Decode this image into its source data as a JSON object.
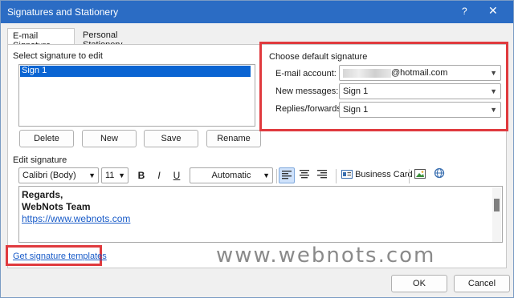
{
  "window": {
    "title": "Signatures and Stationery",
    "help_icon": "?",
    "close_icon": "✕"
  },
  "tabs": [
    {
      "label": "E-mail Signature",
      "active": true
    },
    {
      "label": "Personal Stationery",
      "active": false
    }
  ],
  "select_signature": {
    "label": "Select signature to edit",
    "items": [
      "Sign 1"
    ],
    "selected": "Sign 1"
  },
  "list_buttons": {
    "delete": "Delete",
    "new": "New",
    "save": "Save",
    "rename": "Rename"
  },
  "default_signature": {
    "heading": "Choose default signature",
    "account_label": "E-mail account:",
    "account_value": "@hotmail.com",
    "new_messages_label": "New messages:",
    "new_messages_value": "Sign 1",
    "replies_label": "Replies/forwards:",
    "replies_value": "Sign 1"
  },
  "edit_signature": {
    "label": "Edit signature",
    "font": "Calibri (Body)",
    "size": "11",
    "bold": "B",
    "italic": "I",
    "underline": "U",
    "color": "Automatic",
    "business_card": "Business Card",
    "content_lines": [
      "Regards,",
      "WebNots Team"
    ],
    "link": "https://www.webnots.com"
  },
  "footer": {
    "templates_link": "Get signature templates",
    "watermark": "www.webnots.com",
    "ok": "OK",
    "cancel": "Cancel"
  },
  "colors": {
    "titlebar": "#2b6cc4",
    "highlight": "#0a64d2",
    "annotation": "#e03a3e",
    "link": "#1a5cc8"
  }
}
